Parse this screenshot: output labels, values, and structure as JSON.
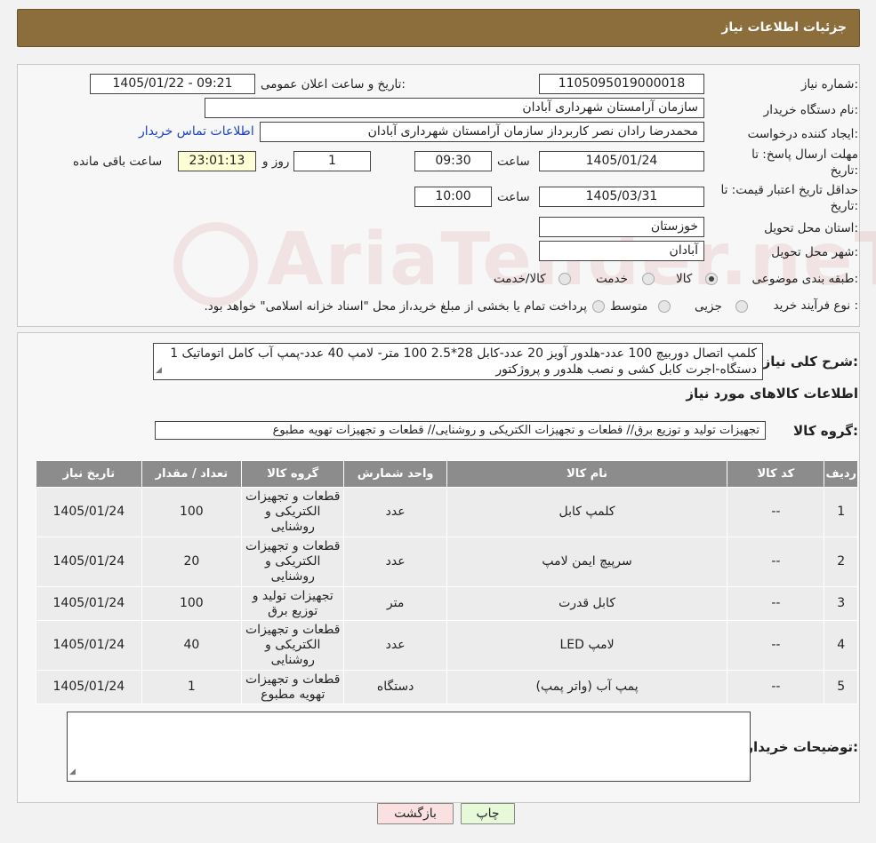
{
  "header": {
    "title": "جزئیات اطلاعات نیاز"
  },
  "form": {
    "need_number_label": "شماره نیاز:",
    "need_number": "1105095019000018",
    "announce_label": "تاریخ و ساعت اعلان عمومی:",
    "announce_value": "1405/01/22 - 09:21",
    "buyer_org_label": "نام دستگاه خریدار:",
    "buyer_org": "سازمان آرامستان شهرداری آبادان",
    "creator_label": "ایجاد کننده درخواست:",
    "creator": "محمدرضا رادان نصر کاربرداز سازمان آرامستان شهرداری آبادان",
    "contact_link": "اطلاعات تماس خریدار",
    "deadline_label_1": "مهلت ارسال پاسخ: تا",
    "deadline_label_2": "تاریخ:",
    "deadline_date": "1405/01/24",
    "time_label": "ساعت",
    "deadline_time": "09:30",
    "days_value": "1",
    "days_label": "روز و",
    "remaining_time": "23:01:13",
    "remaining_label": "ساعت باقی مانده",
    "validity_label_1": "حداقل تاریخ اعتبار قیمت: تا",
    "validity_label_2": "تاریخ:",
    "validity_date": "1405/03/31",
    "validity_time": "10:00",
    "province_label": "استان محل تحویل:",
    "province": "خوزستان",
    "city_label": "شهر محل تحویل:",
    "city": "آبادان",
    "category_label": "طبقه بندی موضوعی:",
    "category_options": [
      "کالا",
      "خدمت",
      "کالا/خدمت"
    ],
    "process_label": "نوع فرآیند خرید :",
    "process_options": [
      "جزیی",
      "متوسط"
    ],
    "process_note": "پرداخت تمام یا بخشی از مبلغ خرید،از محل \"اسناد خزانه اسلامی\" خواهد بود."
  },
  "summary": {
    "label": "شرح کلی نیاز:",
    "text": "کلمپ اتصال دوربیچ 100 عدد-هلدور آویز 20 عدد-کابل 28*2.5 100 متر- لامپ 40 عدد-پمپ آب کامل اتوماتیک 1 دستگاه-اجرت کابل کشی و نصب هلدور و پروژکتور",
    "goods_info_title": "اطلاعات کالاهای مورد نیاز",
    "goods_group_label": "گروه کالا:",
    "goods_group": "تجهیزات تولید و توزیع برق// قطعات و تجهیزات الکتریکی و روشنایی//  قطعات و تجهیزات تهویه مطبوع"
  },
  "table": {
    "headers": [
      "ردیف",
      "کد کالا",
      "نام کالا",
      "واحد شمارش",
      "گروه کالا",
      "تعداد / مقدار",
      "تاریخ نیاز"
    ],
    "rows": [
      [
        "1",
        "--",
        "کلمپ کابل",
        "عدد",
        "قطعات و تجهیزات الکتریکی و روشنایی",
        "100",
        "1405/01/24"
      ],
      [
        "2",
        "--",
        "سرپیچ ایمن لامپ",
        "عدد",
        "قطعات و تجهیزات الکتریکی و روشنایی",
        "20",
        "1405/01/24"
      ],
      [
        "3",
        "--",
        "کابل قدرت",
        "متر",
        "تجهیزات تولید و توزیع برق",
        "100",
        "1405/01/24"
      ],
      [
        "4",
        "--",
        "لامپ LED",
        "عدد",
        "قطعات و تجهیزات الکتریکی و روشنایی",
        "40",
        "1405/01/24"
      ],
      [
        "5",
        "--",
        "پمپ آب (واتر پمپ)",
        "دستگاه",
        "قطعات و تجهیزات تهویه مطبوع",
        "1",
        "1405/01/24"
      ]
    ]
  },
  "buyer_notes": {
    "label": "توضیحات خریدار:",
    "value": ""
  },
  "buttons": {
    "print": "چاپ",
    "back": "بازگشت"
  },
  "watermark": {
    "text": "AriaTender.neT"
  },
  "colors": {
    "header": "#8c6e3c",
    "table_header": "#8c8c8c",
    "print_button": "#e6f9d9",
    "back_button": "#fbe0e0",
    "link": "#1a3fc4"
  }
}
